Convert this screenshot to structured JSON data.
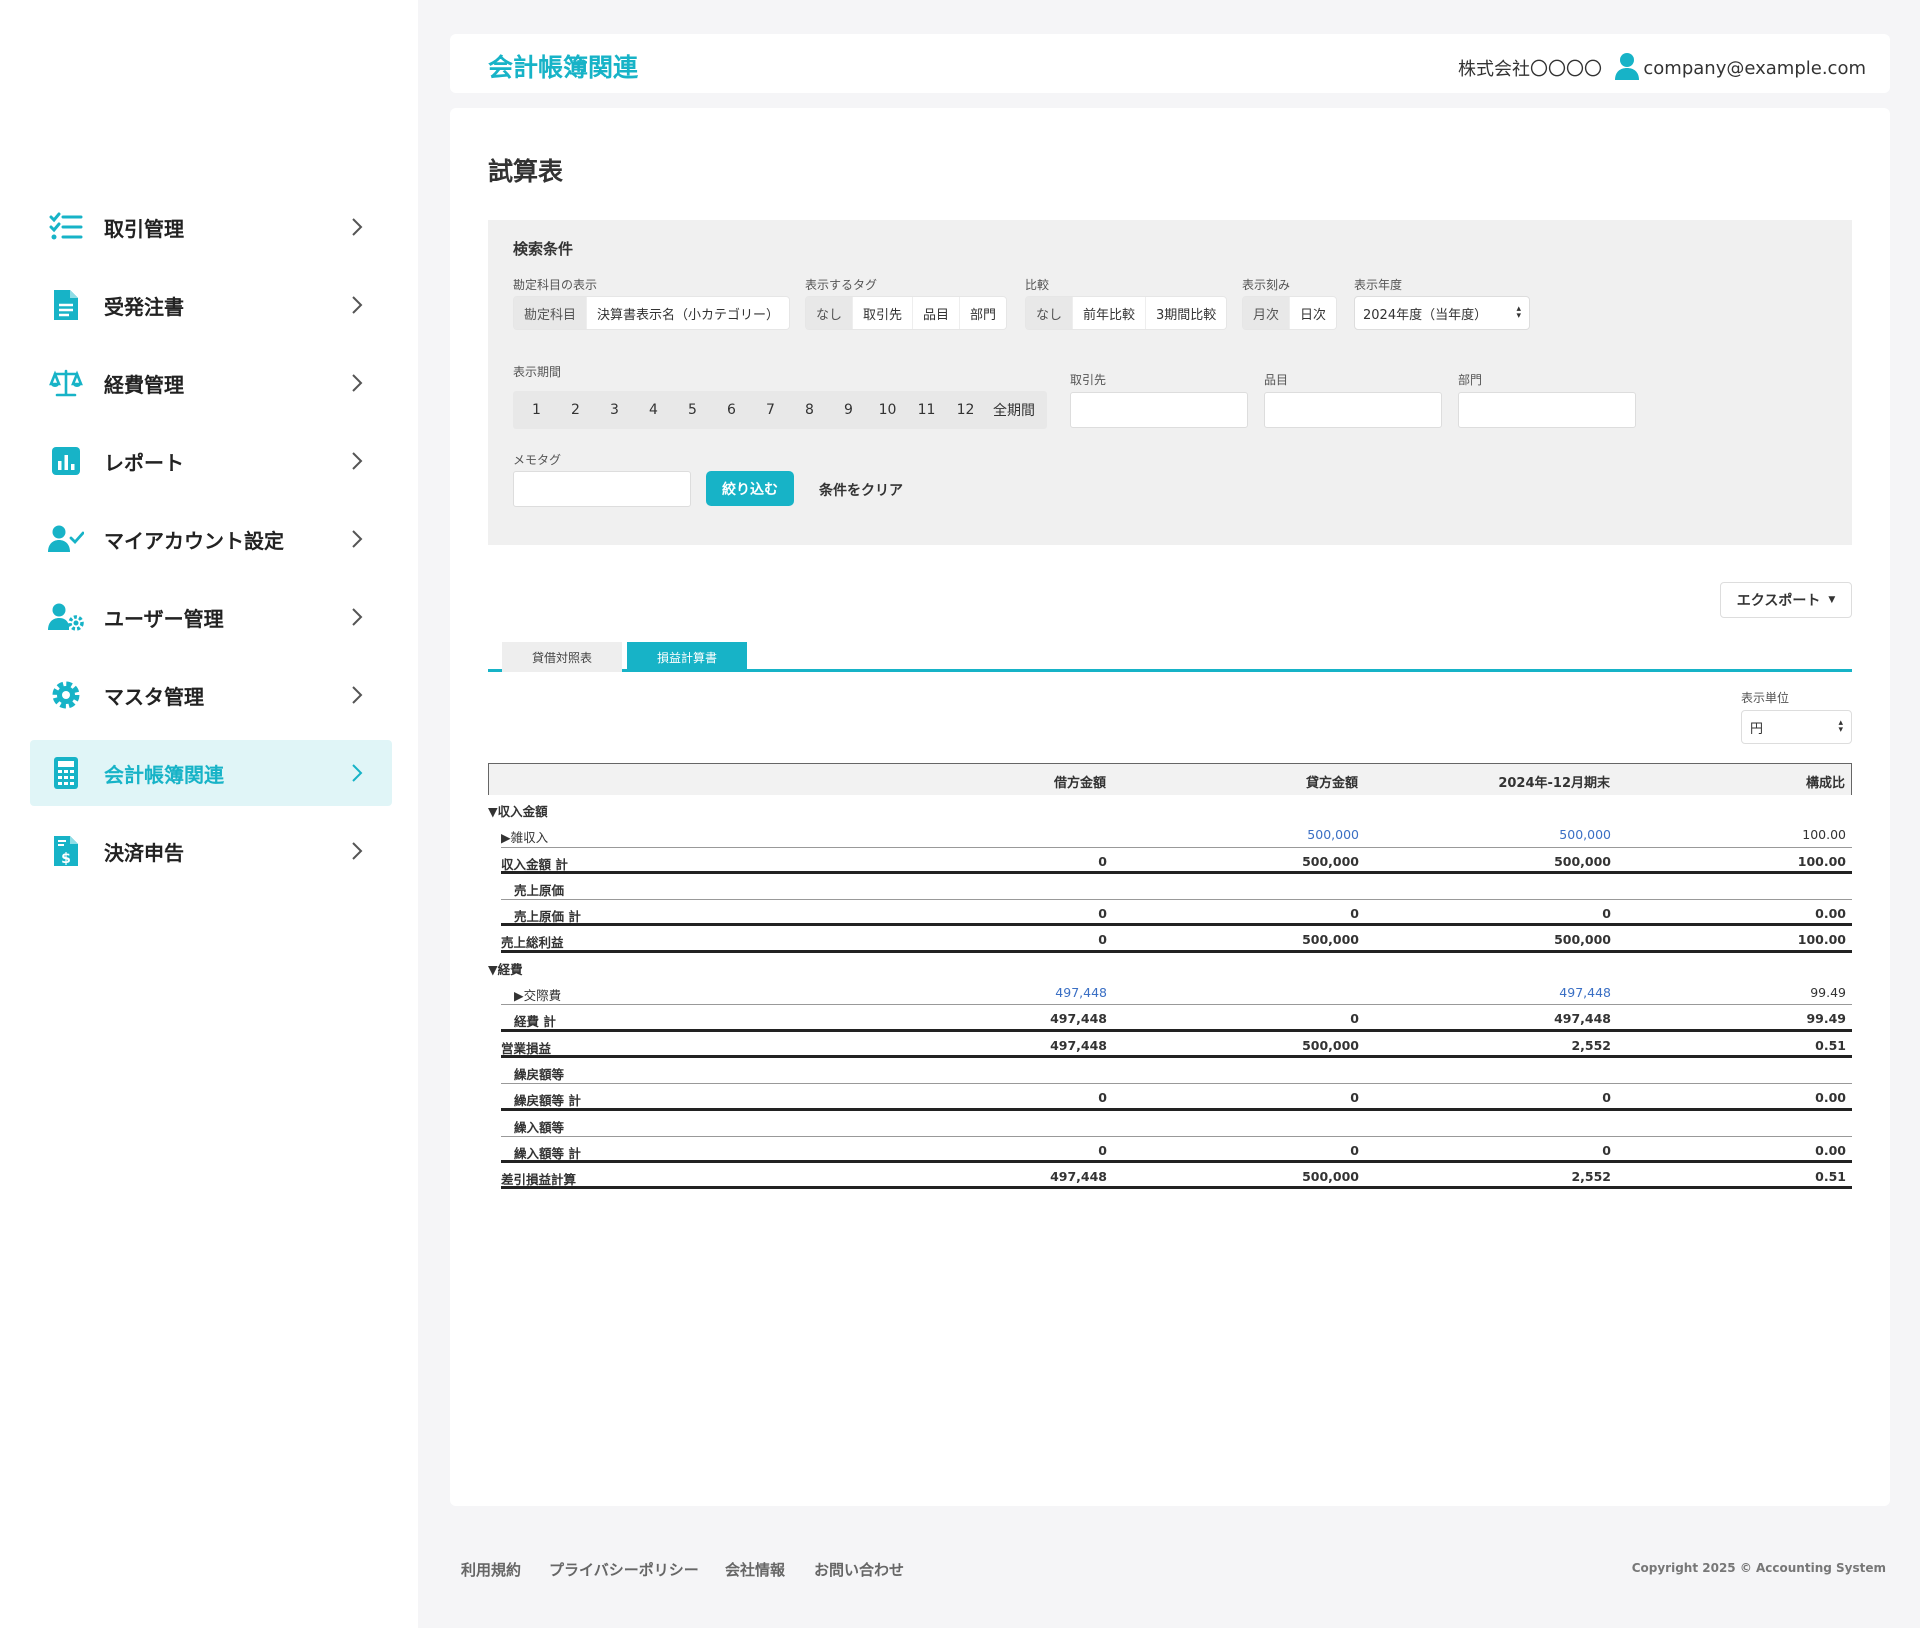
{
  "sidebar": {
    "items": [
      {
        "label": "取引管理",
        "icon": "task-list-icon"
      },
      {
        "label": "受発注書",
        "icon": "document-icon"
      },
      {
        "label": "経費管理",
        "icon": "scale-icon"
      },
      {
        "label": "レポート",
        "icon": "bar-chart-icon"
      },
      {
        "label": "マイアカウント設定",
        "icon": "user-check-icon"
      },
      {
        "label": "ユーザー管理",
        "icon": "user-gear-icon"
      },
      {
        "label": "マスタ管理",
        "icon": "gear-icon"
      },
      {
        "label": "会計帳簿関連",
        "icon": "calculator-icon",
        "active": true
      },
      {
        "label": "決済申告",
        "icon": "invoice-dollar-icon"
      }
    ]
  },
  "header": {
    "title": "会計帳簿関連",
    "company": "株式会社〇〇〇〇",
    "email": "company@example.com"
  },
  "page": {
    "title": "試算表"
  },
  "search": {
    "title": "検索条件",
    "account_display": {
      "label": "勘定科目の表示",
      "options": [
        "勘定科目",
        "決算書表示名（小カテゴリー）"
      ],
      "selected": 0
    },
    "tags": {
      "label": "表示するタグ",
      "options": [
        "なし",
        "取引先",
        "品目",
        "部門"
      ],
      "selected": 0
    },
    "compare": {
      "label": "比較",
      "options": [
        "なし",
        "前年比較",
        "3期間比較"
      ],
      "selected": 0
    },
    "granularity": {
      "label": "表示刻み",
      "options": [
        "月次",
        "日次"
      ],
      "selected": 0
    },
    "fiscal_year": {
      "label": "表示年度",
      "value": "2024年度（当年度）"
    },
    "period": {
      "label": "表示期間",
      "options": [
        "1",
        "2",
        "3",
        "4",
        "5",
        "6",
        "7",
        "8",
        "9",
        "10",
        "11",
        "12",
        "全期間"
      ]
    },
    "partner": {
      "label": "取引先",
      "value": ""
    },
    "item": {
      "label": "品目",
      "value": ""
    },
    "department": {
      "label": "部門",
      "value": ""
    },
    "memo_tag": {
      "label": "メモタグ",
      "value": ""
    },
    "submit_label": "絞り込む",
    "clear_label": "条件をクリア"
  },
  "export_label": "エクスポート",
  "tabs": [
    {
      "label": "貸借対照表",
      "active": false
    },
    {
      "label": "損益計算書",
      "active": true
    }
  ],
  "unit": {
    "label": "表示単位",
    "value": "円"
  },
  "table": {
    "headers": [
      "借方金額",
      "貸方金額",
      "2024年-12月期末",
      "構成比"
    ],
    "rows": [
      {
        "label": "▼収入金額",
        "indent": 0,
        "bold": true,
        "debit": "",
        "credit": "",
        "balance": "",
        "ratio": "",
        "line": "none"
      },
      {
        "label": "▶雑収入",
        "indent": 1,
        "bold": false,
        "debit": "",
        "credit": "500,000",
        "balance": "500,000",
        "ratio": "100.00",
        "link": true,
        "line": "thin"
      },
      {
        "label": "収入金額 計",
        "indent": 1,
        "bold": true,
        "debit": "0",
        "credit": "500,000",
        "balance": "500,000",
        "ratio": "100.00",
        "line": "thick"
      },
      {
        "label": "売上原価",
        "indent": 2,
        "bold": true,
        "debit": "",
        "credit": "",
        "balance": "",
        "ratio": "",
        "line": "thin"
      },
      {
        "label": "売上原価 計",
        "indent": 2,
        "bold": true,
        "debit": "0",
        "credit": "0",
        "balance": "0",
        "ratio": "0.00",
        "line": "thick"
      },
      {
        "label": "売上総利益",
        "indent": 1,
        "bold": true,
        "debit": "0",
        "credit": "500,000",
        "balance": "500,000",
        "ratio": "100.00",
        "line": "thick"
      },
      {
        "label": "▼経費",
        "indent": 1,
        "bold": true,
        "debit": "",
        "credit": "",
        "balance": "",
        "ratio": "",
        "line": "none"
      },
      {
        "label": "▶交際費",
        "indent": 2,
        "bold": false,
        "debit": "497,448",
        "credit": "",
        "balance": "497,448",
        "ratio": "99.49",
        "link": true,
        "line": "thin"
      },
      {
        "label": "経費 計",
        "indent": 2,
        "bold": true,
        "debit": "497,448",
        "credit": "0",
        "balance": "497,448",
        "ratio": "99.49",
        "line": "thick"
      },
      {
        "label": "営業損益",
        "indent": 1,
        "bold": true,
        "debit": "497,448",
        "credit": "500,000",
        "balance": "2,552",
        "ratio": "0.51",
        "line": "thick"
      },
      {
        "label": "繰戻額等",
        "indent": 2,
        "bold": true,
        "debit": "",
        "credit": "",
        "balance": "",
        "ratio": "",
        "line": "thin"
      },
      {
        "label": "繰戻額等 計",
        "indent": 2,
        "bold": true,
        "debit": "0",
        "credit": "0",
        "balance": "0",
        "ratio": "0.00",
        "line": "thick"
      },
      {
        "label": "繰入額等",
        "indent": 2,
        "bold": true,
        "debit": "",
        "credit": "",
        "balance": "",
        "ratio": "",
        "line": "thin"
      },
      {
        "label": "繰入額等 計",
        "indent": 2,
        "bold": true,
        "debit": "0",
        "credit": "0",
        "balance": "0",
        "ratio": "0.00",
        "line": "thick"
      },
      {
        "label": "差引損益計算",
        "indent": 1,
        "bold": true,
        "debit": "497,448",
        "credit": "500,000",
        "balance": "2,552",
        "ratio": "0.51",
        "line": "thick"
      }
    ]
  },
  "footer": {
    "links": [
      "利用規約",
      "プライバシーポリシー",
      "会社情報",
      "お問い合わせ"
    ],
    "copyright": "Copyright 2025 © Accounting System"
  },
  "colors": {
    "accent": "#17b3c7",
    "link": "#3a6fc4",
    "active_bg": "#e0f5f7"
  }
}
